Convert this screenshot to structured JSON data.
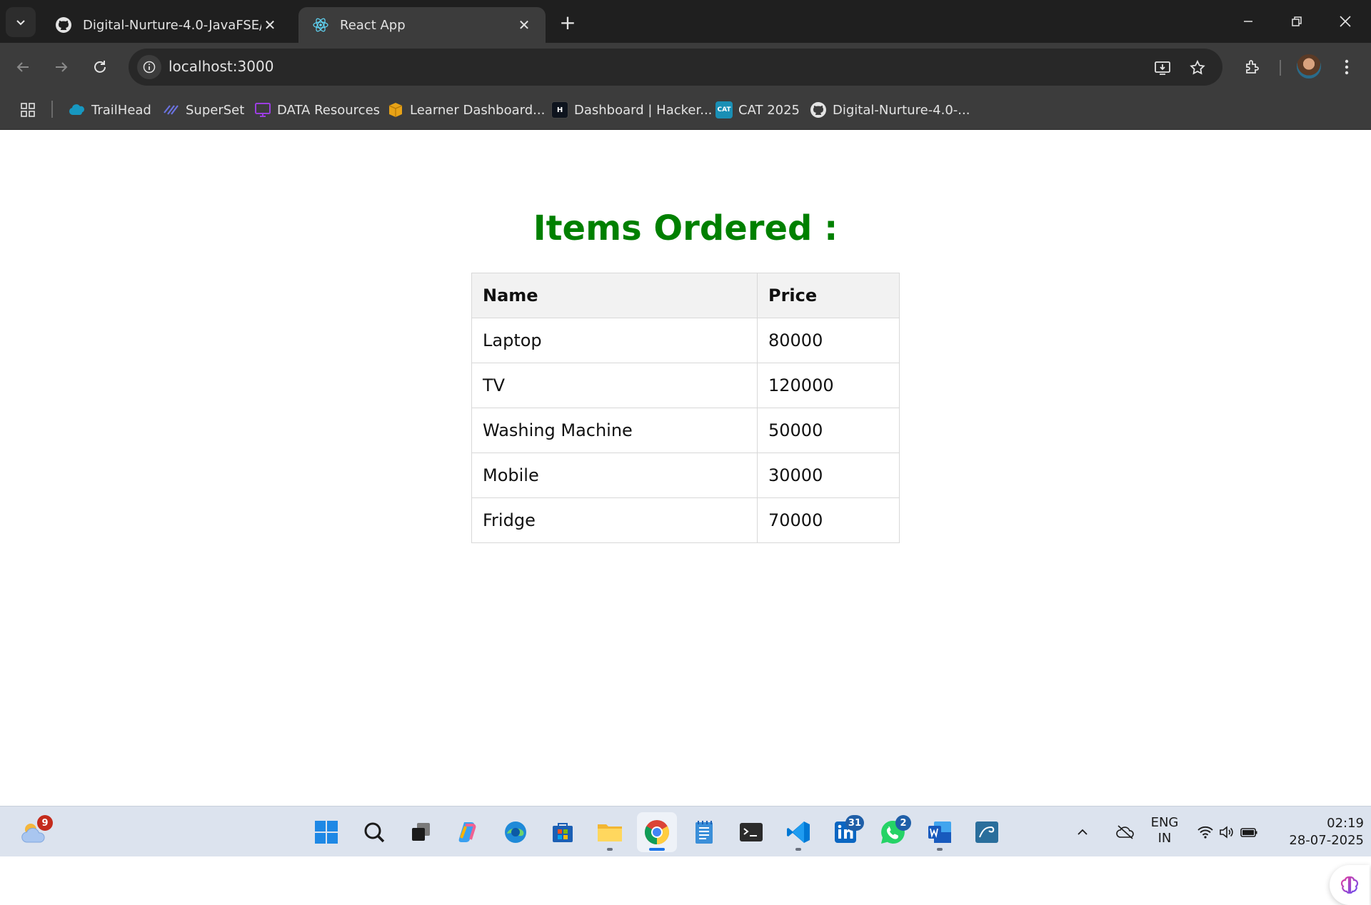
{
  "browser": {
    "tabs": [
      {
        "title": "Digital-Nurture-4.0-JavaFSE/Jav",
        "icon": "github-icon",
        "active": false
      },
      {
        "title": "React App",
        "icon": "react-icon",
        "active": true
      }
    ],
    "address": {
      "url": "localhost:3000"
    },
    "bookmarks": [
      {
        "label": "TrailHead",
        "icon": "salesforce-cloud-icon",
        "color": "#1798c1"
      },
      {
        "label": "SuperSet",
        "icon": "superset-icon",
        "color": "#5a67d8"
      },
      {
        "label": "DATA Resources",
        "icon": "monitor-icon",
        "color": "#8b2fc9"
      },
      {
        "label": "Learner Dashboard...",
        "icon": "box-icon",
        "color": "#e8a317"
      },
      {
        "label": "Dashboard | Hacker...",
        "icon": "hackerrank-icon",
        "color": "#0e141e",
        "icon_text": "H"
      },
      {
        "label": "CAT 2025",
        "icon": "cat-icon",
        "color": "#1a8fb5",
        "icon_text": "CAT"
      },
      {
        "label": "Digital-Nurture-4.0-...",
        "icon": "github-icon",
        "color": "#ffffff"
      }
    ]
  },
  "page": {
    "heading": "Items Ordered :",
    "heading_color": "#008000",
    "table": {
      "headers": [
        "Name",
        "Price"
      ],
      "rows": [
        [
          "Laptop",
          "80000"
        ],
        [
          "TV",
          "120000"
        ],
        [
          "Washing Machine",
          "50000"
        ],
        [
          "Mobile",
          "30000"
        ],
        [
          "Fridge",
          "70000"
        ]
      ]
    }
  },
  "taskbar": {
    "weather_badge": "9",
    "linkedin_badge": "31",
    "whatsapp_badge": "2",
    "language": {
      "line1": "ENG",
      "line2": "IN"
    },
    "time": "02:19",
    "date": "28-07-2025"
  }
}
